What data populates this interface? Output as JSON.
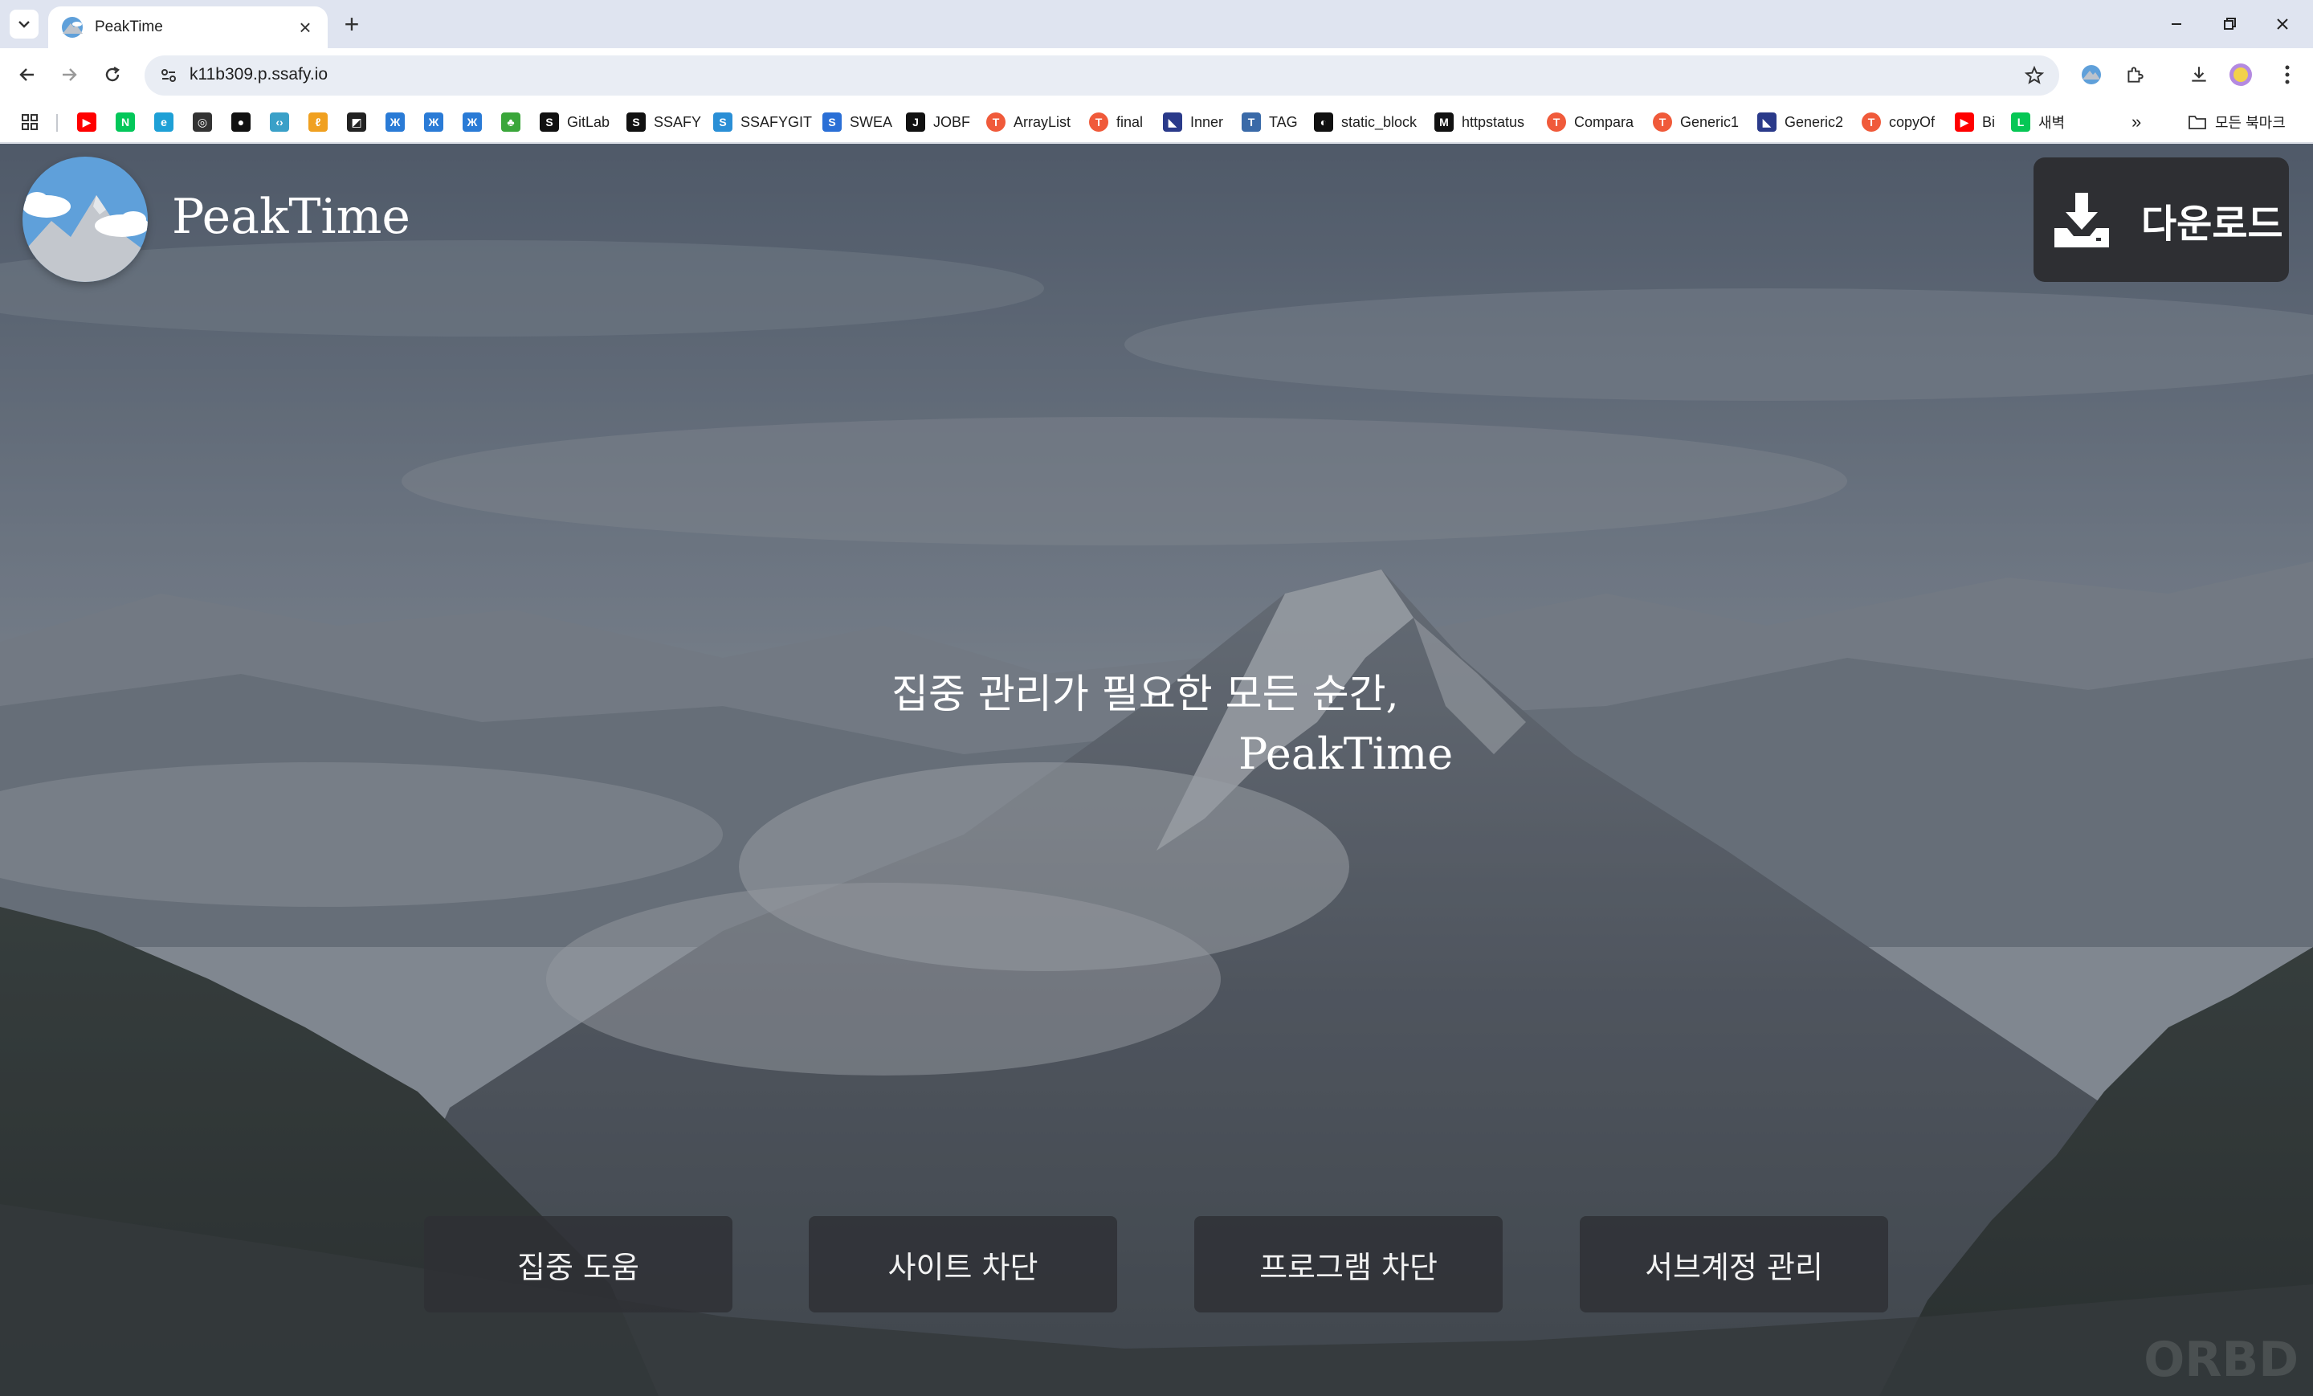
{
  "browser": {
    "tab_title": "PeakTime",
    "url": "k11b309.p.ssafy.io",
    "bookmarks": [
      {
        "label": "",
        "icon": "youtube-icon",
        "color": "#ff0000"
      },
      {
        "label": "",
        "icon": "naver-icon",
        "color": "#03c75a"
      },
      {
        "label": "",
        "icon": "edge-icon",
        "color": "#1ea0d6"
      },
      {
        "label": "",
        "icon": "openai-icon",
        "color": "#333333"
      },
      {
        "label": "",
        "icon": "github-icon",
        "color": "#111111"
      },
      {
        "label": "",
        "icon": "code-icon",
        "color": "#3aa0c8"
      },
      {
        "label": "",
        "icon": "python-tutor-icon",
        "color": "#f0a020"
      },
      {
        "label": "",
        "icon": "notion-like-icon",
        "color": "#222222"
      },
      {
        "label": "",
        "icon": "butterfly-icon",
        "color": "#2a7bd6"
      },
      {
        "label": "",
        "icon": "butterfly-icon",
        "color": "#2a7bd6"
      },
      {
        "label": "",
        "icon": "butterfly-icon",
        "color": "#2a7bd6"
      },
      {
        "label": "",
        "icon": "clover-icon",
        "color": "#3aa63a"
      },
      {
        "label": "GitLab",
        "icon": "gitlab-icon",
        "color": "#111111"
      },
      {
        "label": "SSAFY",
        "icon": "ssafy-icon",
        "color": "#111111"
      },
      {
        "label": "SSAFYGIT",
        "icon": "ssafygit-icon",
        "color": "#2a8fd6"
      },
      {
        "label": "SWEA",
        "icon": "swea-icon",
        "color": "#2a6fd6"
      },
      {
        "label": "JOBF",
        "icon": "jobf-icon",
        "color": "#111111"
      },
      {
        "label": "ArrayList",
        "icon": "tistory-icon",
        "color": "#f05a3a"
      },
      {
        "label": "final",
        "icon": "tistory-icon",
        "color": "#f05a3a"
      },
      {
        "label": "Inner",
        "icon": "inner-icon",
        "color": "#2a3a8a"
      },
      {
        "label": "TAG",
        "icon": "tag-icon",
        "color": "#3a6aa8"
      },
      {
        "label": "static_block",
        "icon": "static-block-icon",
        "color": "#111111"
      },
      {
        "label": "httpstatus",
        "icon": "httpstatus-icon",
        "color": "#111111"
      },
      {
        "label": "Compara",
        "icon": "tistory-icon",
        "color": "#f05a3a"
      },
      {
        "label": "Generic1",
        "icon": "tistory-icon",
        "color": "#f05a3a"
      },
      {
        "label": "Generic2",
        "icon": "generic2-icon",
        "color": "#2a3a8a"
      },
      {
        "label": "copyOf",
        "icon": "tistory-icon",
        "color": "#f05a3a"
      },
      {
        "label": "Bi",
        "icon": "youtube-icon",
        "color": "#ff0000"
      },
      {
        "label": "새벽",
        "icon": "line-icon",
        "color": "#06c755"
      }
    ],
    "bookmarks_overflow": "»",
    "all_bookmarks_label": "모든 북마크"
  },
  "page": {
    "brand": "PeakTime",
    "download_label": "다운로드",
    "headline": "집중 관리가 필요한 모든 순간,",
    "headline_brand": "PeakTime",
    "features": [
      "집중 도움",
      "사이트 차단",
      "프로그램 차단",
      "서브계정 관리"
    ],
    "watermark": "ORBD"
  },
  "colors": {
    "download_bg": "#2e2f33",
    "feature_bg": "#2e3034",
    "logo_sky": "#5fa0da"
  }
}
